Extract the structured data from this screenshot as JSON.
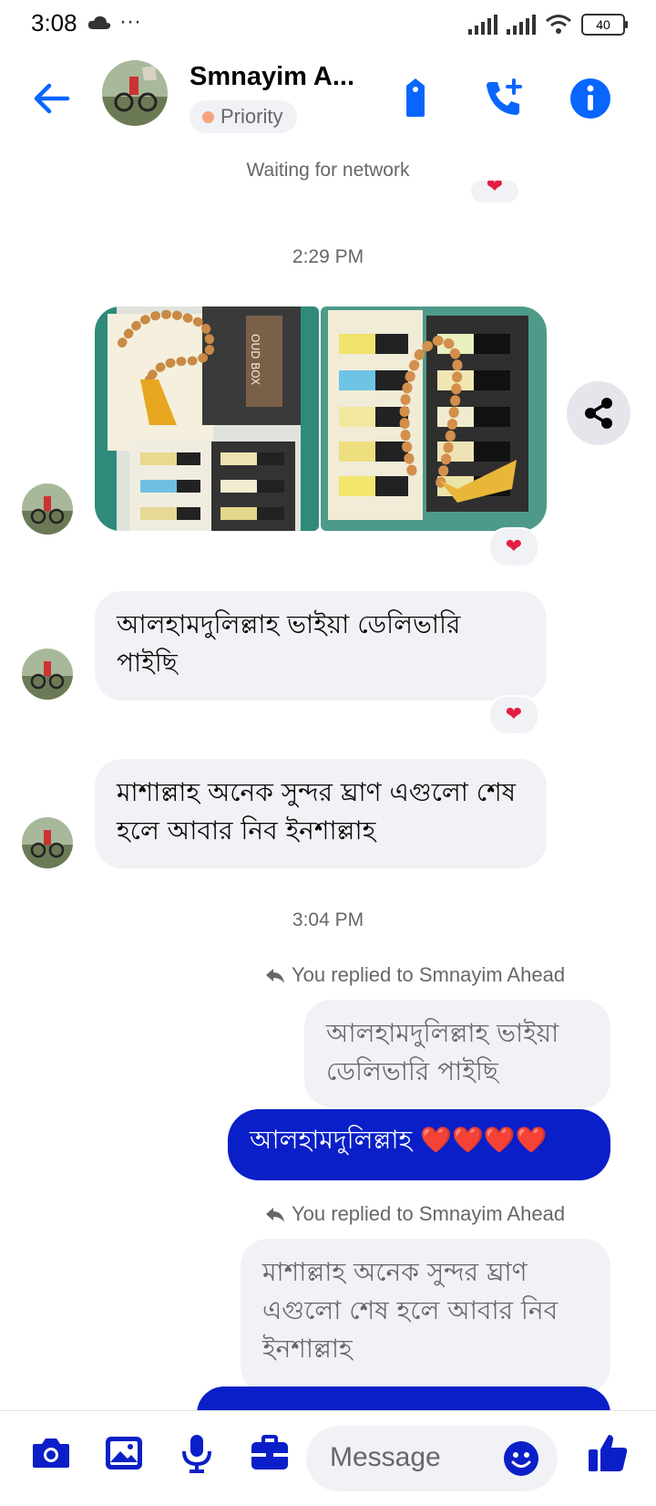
{
  "status_bar": {
    "time": "3:08",
    "battery": "40"
  },
  "header": {
    "contact_name": "Smnayim A...",
    "badge": "Priority"
  },
  "network_status": "Waiting for network",
  "conversation": {
    "time_1": "2:29 PM",
    "msg_in_1": "আলহামদুলিল্লাহ ভাইয়া ডেলিভারি পাইছি",
    "msg_in_2": "মাশাল্লাহ অনেক সুন্দর ঘ্রাণ এগুলো শেষ হলে আবার নিব ইনশাল্লাহ",
    "time_2": "3:04 PM",
    "reply_1_label": "You replied to Smnayim Ahead",
    "reply_1_quote": "আলহামদুলিল্লাহ ভাইয়া ডেলিভারি পাইছি",
    "reply_1_text": "আলহামদুলিল্লাহ ❤️❤️❤️❤️",
    "reply_2_label": "You replied to Smnayim Ahead",
    "reply_2_quote": "মাশাল্লাহ অনেক সুন্দর ঘ্রাণ এগুলো শেষ হলে আবার নিব ইনশাল্লাহ",
    "photo_1_text": "OUD BOX"
  },
  "reaction": "❤",
  "composer": {
    "placeholder": "Message"
  },
  "colors": {
    "accent": "#0866ff",
    "outgoing_bubble": "#0a1fc7"
  }
}
